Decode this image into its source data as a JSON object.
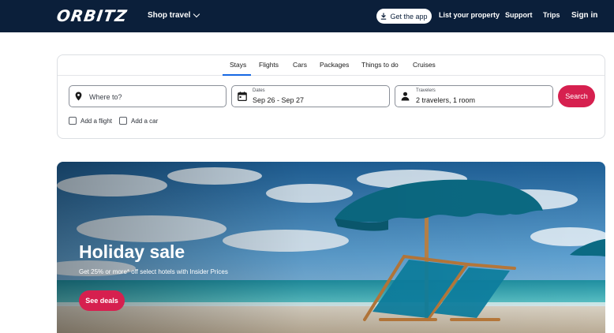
{
  "header": {
    "logo_text": "ORBITZ",
    "shop_travel": "Shop travel",
    "get_app": "Get the app",
    "list_property": "List your property",
    "support": "Support",
    "trips": "Trips",
    "sign_in": "Sign in"
  },
  "search": {
    "tabs": [
      {
        "label": "Stays",
        "active": true
      },
      {
        "label": "Flights"
      },
      {
        "label": "Cars"
      },
      {
        "label": "Packages"
      },
      {
        "label": "Things to do"
      },
      {
        "label": "Cruises"
      }
    ],
    "where_placeholder": "Where to?",
    "dates_label": "Dates",
    "dates_value": "Sep 26 - Sep 27",
    "travelers_label": "Travelers",
    "travelers_value": "2 travelers, 1 room",
    "search_button": "Search",
    "add_flight": "Add a flight",
    "add_car": "Add a car"
  },
  "hero": {
    "title": "Holiday sale",
    "subtitle": "Get 25% or more* off select hotels with Insider Prices",
    "cta": "See deals"
  },
  "colors": {
    "header_bg": "#0b1f3a",
    "accent": "#d6204f",
    "tab_active": "#1668e3"
  },
  "icons": {
    "download": "download-icon",
    "location": "map-pin-icon",
    "calendar": "calendar-icon",
    "person": "person-icon"
  }
}
